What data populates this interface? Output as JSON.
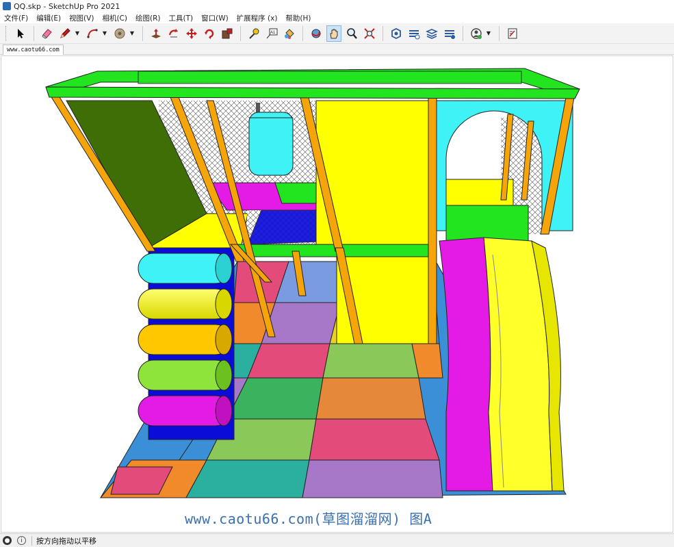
{
  "window": {
    "title": "QQ.skp - SketchUp Pro 2021"
  },
  "menu": [
    "文件(F)",
    "编辑(E)",
    "视图(V)",
    "相机(C)",
    "绘图(R)",
    "工具(T)",
    "窗口(W)",
    "扩展程序 (x)",
    "帮助(H)"
  ],
  "toolbar": {
    "tools": [
      "select-tool-icon",
      "eraser-tool-icon",
      "pencil-tool-icon",
      "arc-tool-icon",
      "paint-tool-icon",
      "push-pull-tool-icon",
      "rotate-tool-icon",
      "move-tool-icon",
      "follow-me-tool-icon",
      "scale-tool-icon",
      "tape-measure-icon",
      "text-tool-icon",
      "paint-bucket-icon",
      "orbit-tool-icon",
      "pan-tool-icon",
      "zoom-tool-icon",
      "zoom-extents-icon",
      "warehouse-icon",
      "extension-warehouse-icon",
      "layout-icon",
      "extension-manager-icon",
      "account-icon",
      "report-icon"
    ],
    "active_tool": "pan-tool-icon",
    "text_tool_label": "A1"
  },
  "scene_tab": {
    "label": "www.caotu66.com"
  },
  "watermark": {
    "text": "www.caotu66.com(草图溜溜网) 图A"
  },
  "status": {
    "hint": "按方向拖动以平移"
  },
  "colors": {
    "frame_green": "#22e51f",
    "pole_orange": "#f5a50a",
    "panel_yellow": "#ffff00",
    "panel_cyan": "#3ff2f5",
    "panel_olive": "#3f6e07",
    "panel_blue": "#0c0cd8",
    "slide_magenta": "#e41be4",
    "slide_yellow": "#ffff2a",
    "accent_blue": "#3a6fb0"
  }
}
